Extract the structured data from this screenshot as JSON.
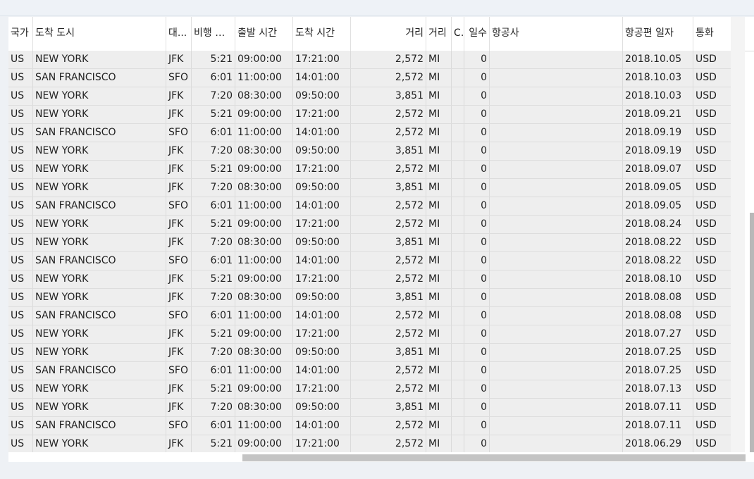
{
  "columns": [
    {
      "key": "country",
      "label": "국가"
    },
    {
      "key": "city",
      "label": "도착 도시"
    },
    {
      "key": "airport",
      "label": "대..."
    },
    {
      "key": "flight_time",
      "label": "비행 시..."
    },
    {
      "key": "dep_time",
      "label": "출발 시간"
    },
    {
      "key": "arr_time",
      "label": "도착 시간"
    },
    {
      "key": "distance",
      "label": "거리"
    },
    {
      "key": "unit",
      "label": "거리"
    },
    {
      "key": "ch",
      "label": "Ch"
    },
    {
      "key": "days",
      "label": "일수"
    },
    {
      "key": "airline",
      "label": "항공사"
    },
    {
      "key": "date",
      "label": "항공편 일자"
    },
    {
      "key": "currency",
      "label": "통화"
    }
  ],
  "rows": [
    {
      "country": "US",
      "city": "NEW YORK",
      "airport": "JFK",
      "flight_time": "5:21",
      "dep_time": "09:00:00",
      "arr_time": "17:21:00",
      "distance": "2,572",
      "unit": "MI",
      "ch": "",
      "days": "0",
      "airline": "",
      "date": "2018.10.05",
      "currency": "USD"
    },
    {
      "country": "US",
      "city": "SAN FRANCISCO",
      "airport": "SFO",
      "flight_time": "6:01",
      "dep_time": "11:00:00",
      "arr_time": "14:01:00",
      "distance": "2,572",
      "unit": "MI",
      "ch": "",
      "days": "0",
      "airline": "",
      "date": "2018.10.03",
      "currency": "USD"
    },
    {
      "country": "US",
      "city": "NEW YORK",
      "airport": "JFK",
      "flight_time": "7:20",
      "dep_time": "08:30:00",
      "arr_time": "09:50:00",
      "distance": "3,851",
      "unit": "MI",
      "ch": "",
      "days": "0",
      "airline": "",
      "date": "2018.10.03",
      "currency": "USD"
    },
    {
      "country": "US",
      "city": "NEW YORK",
      "airport": "JFK",
      "flight_time": "5:21",
      "dep_time": "09:00:00",
      "arr_time": "17:21:00",
      "distance": "2,572",
      "unit": "MI",
      "ch": "",
      "days": "0",
      "airline": "",
      "date": "2018.09.21",
      "currency": "USD"
    },
    {
      "country": "US",
      "city": "SAN FRANCISCO",
      "airport": "SFO",
      "flight_time": "6:01",
      "dep_time": "11:00:00",
      "arr_time": "14:01:00",
      "distance": "2,572",
      "unit": "MI",
      "ch": "",
      "days": "0",
      "airline": "",
      "date": "2018.09.19",
      "currency": "USD"
    },
    {
      "country": "US",
      "city": "NEW YORK",
      "airport": "JFK",
      "flight_time": "7:20",
      "dep_time": "08:30:00",
      "arr_time": "09:50:00",
      "distance": "3,851",
      "unit": "MI",
      "ch": "",
      "days": "0",
      "airline": "",
      "date": "2018.09.19",
      "currency": "USD"
    },
    {
      "country": "US",
      "city": "NEW YORK",
      "airport": "JFK",
      "flight_time": "5:21",
      "dep_time": "09:00:00",
      "arr_time": "17:21:00",
      "distance": "2,572",
      "unit": "MI",
      "ch": "",
      "days": "0",
      "airline": "",
      "date": "2018.09.07",
      "currency": "USD"
    },
    {
      "country": "US",
      "city": "NEW YORK",
      "airport": "JFK",
      "flight_time": "7:20",
      "dep_time": "08:30:00",
      "arr_time": "09:50:00",
      "distance": "3,851",
      "unit": "MI",
      "ch": "",
      "days": "0",
      "airline": "",
      "date": "2018.09.05",
      "currency": "USD"
    },
    {
      "country": "US",
      "city": "SAN FRANCISCO",
      "airport": "SFO",
      "flight_time": "6:01",
      "dep_time": "11:00:00",
      "arr_time": "14:01:00",
      "distance": "2,572",
      "unit": "MI",
      "ch": "",
      "days": "0",
      "airline": "",
      "date": "2018.09.05",
      "currency": "USD"
    },
    {
      "country": "US",
      "city": "NEW YORK",
      "airport": "JFK",
      "flight_time": "5:21",
      "dep_time": "09:00:00",
      "arr_time": "17:21:00",
      "distance": "2,572",
      "unit": "MI",
      "ch": "",
      "days": "0",
      "airline": "",
      "date": "2018.08.24",
      "currency": "USD"
    },
    {
      "country": "US",
      "city": "NEW YORK",
      "airport": "JFK",
      "flight_time": "7:20",
      "dep_time": "08:30:00",
      "arr_time": "09:50:00",
      "distance": "3,851",
      "unit": "MI",
      "ch": "",
      "days": "0",
      "airline": "",
      "date": "2018.08.22",
      "currency": "USD"
    },
    {
      "country": "US",
      "city": "SAN FRANCISCO",
      "airport": "SFO",
      "flight_time": "6:01",
      "dep_time": "11:00:00",
      "arr_time": "14:01:00",
      "distance": "2,572",
      "unit": "MI",
      "ch": "",
      "days": "0",
      "airline": "",
      "date": "2018.08.22",
      "currency": "USD"
    },
    {
      "country": "US",
      "city": "NEW YORK",
      "airport": "JFK",
      "flight_time": "5:21",
      "dep_time": "09:00:00",
      "arr_time": "17:21:00",
      "distance": "2,572",
      "unit": "MI",
      "ch": "",
      "days": "0",
      "airline": "",
      "date": "2018.08.10",
      "currency": "USD"
    },
    {
      "country": "US",
      "city": "NEW YORK",
      "airport": "JFK",
      "flight_time": "7:20",
      "dep_time": "08:30:00",
      "arr_time": "09:50:00",
      "distance": "3,851",
      "unit": "MI",
      "ch": "",
      "days": "0",
      "airline": "",
      "date": "2018.08.08",
      "currency": "USD"
    },
    {
      "country": "US",
      "city": "SAN FRANCISCO",
      "airport": "SFO",
      "flight_time": "6:01",
      "dep_time": "11:00:00",
      "arr_time": "14:01:00",
      "distance": "2,572",
      "unit": "MI",
      "ch": "",
      "days": "0",
      "airline": "",
      "date": "2018.08.08",
      "currency": "USD"
    },
    {
      "country": "US",
      "city": "NEW YORK",
      "airport": "JFK",
      "flight_time": "5:21",
      "dep_time": "09:00:00",
      "arr_time": "17:21:00",
      "distance": "2,572",
      "unit": "MI",
      "ch": "",
      "days": "0",
      "airline": "",
      "date": "2018.07.27",
      "currency": "USD"
    },
    {
      "country": "US",
      "city": "NEW YORK",
      "airport": "JFK",
      "flight_time": "7:20",
      "dep_time": "08:30:00",
      "arr_time": "09:50:00",
      "distance": "3,851",
      "unit": "MI",
      "ch": "",
      "days": "0",
      "airline": "",
      "date": "2018.07.25",
      "currency": "USD"
    },
    {
      "country": "US",
      "city": "SAN FRANCISCO",
      "airport": "SFO",
      "flight_time": "6:01",
      "dep_time": "11:00:00",
      "arr_time": "14:01:00",
      "distance": "2,572",
      "unit": "MI",
      "ch": "",
      "days": "0",
      "airline": "",
      "date": "2018.07.25",
      "currency": "USD"
    },
    {
      "country": "US",
      "city": "NEW YORK",
      "airport": "JFK",
      "flight_time": "5:21",
      "dep_time": "09:00:00",
      "arr_time": "17:21:00",
      "distance": "2,572",
      "unit": "MI",
      "ch": "",
      "days": "0",
      "airline": "",
      "date": "2018.07.13",
      "currency": "USD"
    },
    {
      "country": "US",
      "city": "NEW YORK",
      "airport": "JFK",
      "flight_time": "7:20",
      "dep_time": "08:30:00",
      "arr_time": "09:50:00",
      "distance": "3,851",
      "unit": "MI",
      "ch": "",
      "days": "0",
      "airline": "",
      "date": "2018.07.11",
      "currency": "USD"
    },
    {
      "country": "US",
      "city": "SAN FRANCISCO",
      "airport": "SFO",
      "flight_time": "6:01",
      "dep_time": "11:00:00",
      "arr_time": "14:01:00",
      "distance": "2,572",
      "unit": "MI",
      "ch": "",
      "days": "0",
      "airline": "",
      "date": "2018.07.11",
      "currency": "USD"
    },
    {
      "country": "US",
      "city": "NEW YORK",
      "airport": "JFK",
      "flight_time": "5:21",
      "dep_time": "09:00:00",
      "arr_time": "17:21:00",
      "distance": "2,572",
      "unit": "MI",
      "ch": "",
      "days": "0",
      "airline": "",
      "date": "2018.06.29",
      "currency": "USD"
    }
  ]
}
